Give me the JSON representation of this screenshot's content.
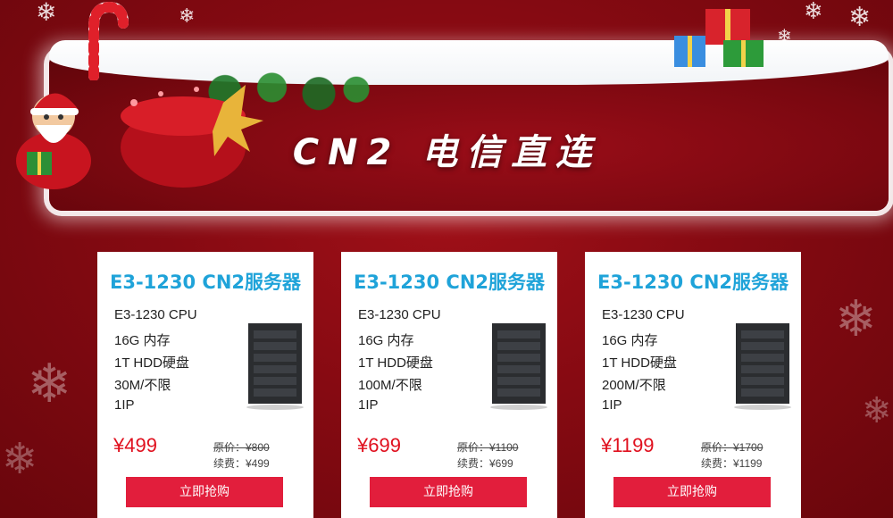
{
  "banner": {
    "title": "CN2 电信直连"
  },
  "cards": [
    {
      "title": "E3-1230 CN2服务器",
      "specs": [
        "E3-1230 CPU",
        "16G 内存",
        "1T HDD硬盘",
        "30M/不限",
        "1IP"
      ],
      "price": "¥499",
      "original": "原价：¥800",
      "renewal": "续费：¥499",
      "buy_label": "立即抢购"
    },
    {
      "title": "E3-1230 CN2服务器",
      "specs": [
        "E3-1230 CPU",
        "16G 内存",
        "1T HDD硬盘",
        "100M/不限",
        "1IP"
      ],
      "price": "¥699",
      "original": "原价：¥1100",
      "renewal": "续费：¥699",
      "buy_label": "立即抢购"
    },
    {
      "title": "E3-1230 CN2服务器",
      "specs": [
        "E3-1230 CPU",
        "16G 内存",
        "1T HDD硬盘",
        "200M/不限",
        "1IP"
      ],
      "price": "¥1199",
      "original": "原价：¥1700",
      "renewal": "续费：¥1199",
      "buy_label": "立即抢购"
    }
  ],
  "colors": {
    "background": "#860a12",
    "title_blue": "#1fa3d9",
    "price_red": "#e0101e",
    "button_red": "#e21e3c"
  },
  "icons": [
    "snowflake-icon",
    "server-rack-icon",
    "santa-icon",
    "gift-icon",
    "candy-cane-icon"
  ]
}
